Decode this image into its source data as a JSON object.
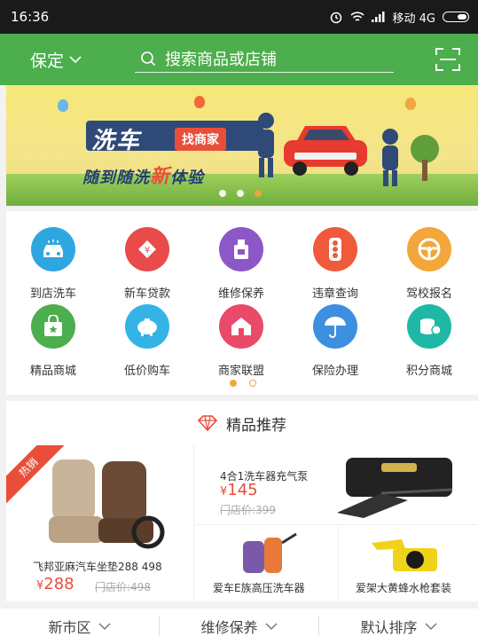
{
  "status_bar": {
    "time": "16:36",
    "carrier": "移动 4G"
  },
  "header": {
    "city": "保定",
    "search_placeholder": "搜索商品或店铺"
  },
  "banner": {
    "title": "洗车",
    "tag": "找商家",
    "slogan_a": "随到随洗",
    "slogan_b": "新",
    "slogan_c": "体验",
    "active_dot": 2
  },
  "grid": {
    "row1": [
      {
        "label": "到店洗车",
        "color": "#2ea6e0",
        "icon": "car-wash-icon"
      },
      {
        "label": "新车贷款",
        "color": "#e94a4a",
        "icon": "loan-icon"
      },
      {
        "label": "维修保养",
        "color": "#8c57c6",
        "icon": "oil-bottle-icon"
      },
      {
        "label": "违章查询",
        "color": "#ef5a3a",
        "icon": "traffic-light-icon"
      },
      {
        "label": "驾校报名",
        "color": "#f3a63a",
        "icon": "steering-wheel-icon"
      }
    ],
    "row2": [
      {
        "label": "精品商城",
        "color": "#4cae4c",
        "icon": "shopping-bag-icon"
      },
      {
        "label": "低价购车",
        "color": "#34b3e6",
        "icon": "piggy-bank-icon"
      },
      {
        "label": "商家联盟",
        "color": "#ea4a6a",
        "icon": "house-icon"
      },
      {
        "label": "保险办理",
        "color": "#3d8fe0",
        "icon": "umbrella-icon"
      },
      {
        "label": "积分商城",
        "color": "#1fb8a6",
        "icon": "coins-icon"
      }
    ]
  },
  "recommend": {
    "title": "精品推荐",
    "hot_tag": "热销",
    "big": {
      "name": "飞邦亚麻汽车坐垫288 498",
      "currency": "¥",
      "price": "288",
      "orig": "门店价:498"
    },
    "top": {
      "name": "4合1洗车器充气泵",
      "currency": "¥",
      "price": "145",
      "orig": "门店价:399"
    },
    "bl": {
      "name": "爱车E族高压洗车器"
    },
    "br": {
      "name": "爱架大黄蜂水枪套装"
    }
  },
  "filter": {
    "district": "新市区",
    "category": "维修保养",
    "sort": "默认排序"
  }
}
